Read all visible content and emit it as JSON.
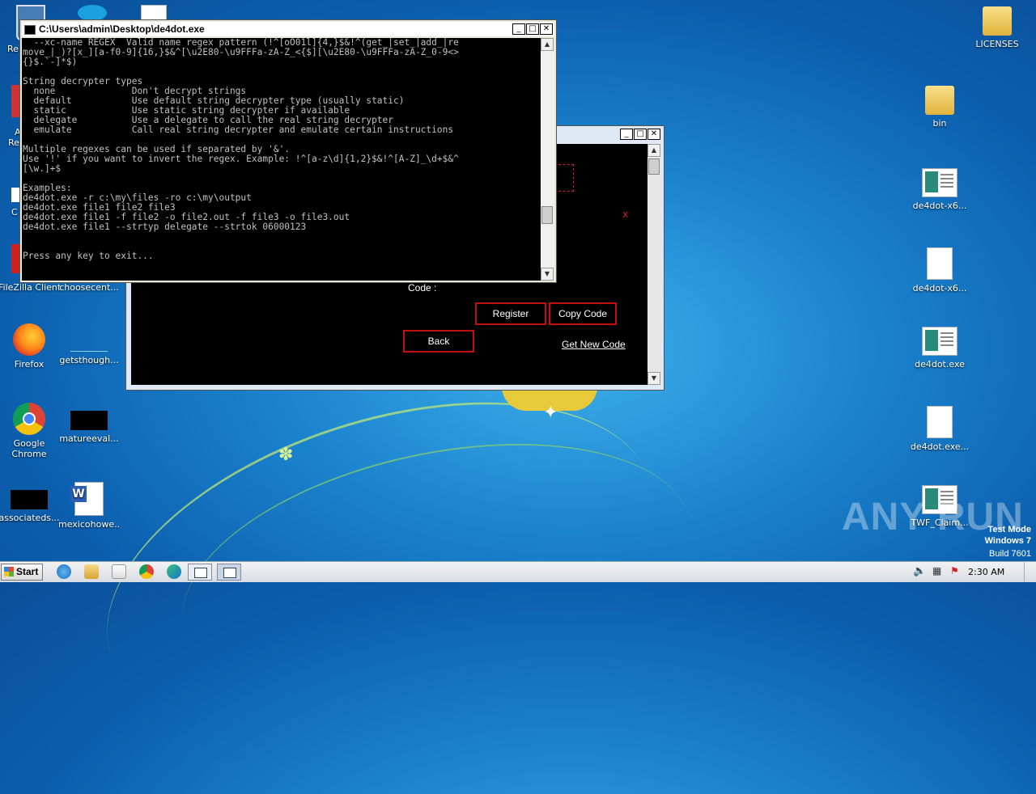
{
  "desktop": {
    "left_icons": [
      {
        "name": "recycle-bin-icon",
        "label": "Re",
        "type": "blank"
      },
      {
        "name": "filezilla-icon",
        "label": "FileZilla Client",
        "type": "blank"
      },
      {
        "name": "choosecent-icon",
        "label": "choosecent...",
        "type": "blank"
      },
      {
        "name": "firefox-icon",
        "label": "Firefox",
        "type": "ff"
      },
      {
        "name": "getsthough-icon",
        "label": "getsthough...",
        "type": "blank"
      },
      {
        "name": "chrome-icon",
        "label": "Google Chrome",
        "type": "chrome"
      },
      {
        "name": "matureeval-icon",
        "label": "matureeval...",
        "type": "black"
      },
      {
        "name": "associateds-icon",
        "label": "associateds...",
        "type": "black"
      },
      {
        "name": "mexicohowe-icon",
        "label": "mexicohowe...",
        "type": "word"
      }
    ],
    "right_icons": [
      {
        "name": "licenses-folder-icon",
        "label": "LICENSES",
        "type": "folder"
      },
      {
        "name": "bin-folder-icon",
        "label": "bin",
        "type": "folder"
      },
      {
        "name": "de4dot-x64-exe-icon",
        "label": "de4dot-x6...",
        "type": "exe"
      },
      {
        "name": "de4dot-x64-file-icon",
        "label": "de4dot-x6...",
        "type": "doc"
      },
      {
        "name": "de4dot-exe-icon",
        "label": "de4dot.exe",
        "type": "exe"
      },
      {
        "name": "de4dot-exe-file-icon",
        "label": "de4dot.exe...",
        "type": "doc"
      },
      {
        "name": "twf-claim-icon",
        "label": "TWF_Claim...",
        "type": "exe"
      }
    ],
    "partial_labels": {
      "a1": "A",
      "a2": "Re",
      "c": "C"
    }
  },
  "console": {
    "title": "C:\\Users\\admin\\Desktop\\de4dot.exe",
    "lines": [
      "  --xc-name REGEX  Valid name regex pattern (!^[oO01l]{4,}$&!^(get_|set_|add_|re",
      "move_|_)?[x_][a-f0-9]{16,}$&^[\\u2E80-\\u9FFFa-zA-Z_<{$][\\u2E80-\\u9FFFa-zA-Z_0-9<>",
      "{}$.`-]*$)",
      "",
      "String decrypter types",
      "  none              Don't decrypt strings",
      "  default           Use default string decrypter type (usually static)",
      "  static            Use static string decrypter if available",
      "  delegate          Use a delegate to call the real string decrypter",
      "  emulate           Call real string decrypter and emulate certain instructions",
      "",
      "Multiple regexes can be used if separated by '&'.",
      "Use '!' if you want to invert the regex. Example: !^[a-z\\d]{1,2}$&!^[A-Z]_\\d+$&^",
      "[\\w.]+$",
      "",
      "Examples:",
      "de4dot.exe -r c:\\my\\files -ro c:\\my\\output",
      "de4dot.exe file1 file2 file3",
      "de4dot.exe file1 -f file2 -o file2.out -f file3 -o file3.out",
      "de4dot.exe file1 --strtyp delegate --strtok 06000123",
      "",
      "",
      "Press any key to exit..."
    ]
  },
  "gui": {
    "code_label": "Code :",
    "register": "Register",
    "copy_code": "Copy Code",
    "back": "Back",
    "get_new_code": "Get New Code",
    "close_mark": "x"
  },
  "taskbar": {
    "start": "Start",
    "clock": "2:30 AM"
  },
  "overlay": {
    "watermark": "ANY RUN",
    "test_mode": "Test Mode",
    "os": "Windows 7",
    "build": "Build 7601"
  }
}
